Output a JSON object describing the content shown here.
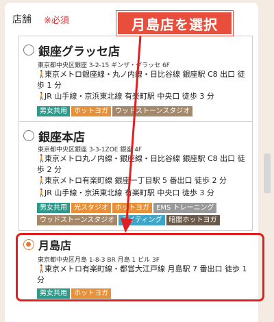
{
  "header": {
    "label": "店舗",
    "required": "※必須",
    "annotation": "月島店を選択"
  },
  "stores": [
    {
      "name": "銀座グラッセ店",
      "selected": false,
      "address": "東京都中央区銀座 3-2-15 ギンザ・グラッセ 6F",
      "routes": [
        "東京メトロ銀座線・丸ノ内線・日比谷線 銀座駅 C8 出口 徒歩 1 分",
        "JR 山手線・京浜東北線 有楽町駅 中央口 徒歩 3 分"
      ],
      "tags": [
        "男女共用",
        "ホットヨガ",
        "ウッドストーンスタジオ"
      ]
    },
    {
      "name": "銀座本店",
      "selected": false,
      "address": "東京都中央区銀座 3-3-1ZOE 銀座 4F",
      "routes": [
        "東京メトロ丸ノ内線・銀座線・日比谷線 銀座駅 C8 出口 徒歩 2 分",
        "東京メトロ有楽町線 銀座一丁目駅 5 番出口 徒歩 2 分",
        "JR 山手線・京浜東北線 有楽町駅 中央口 徒歩 3 分"
      ],
      "tags": [
        "男女共用",
        "光スタジオ",
        "ホットヨガ",
        "EMS トレーニング",
        "ウッドストーンスタジオ",
        "ライティング",
        "暗闇ホットヨガ"
      ]
    },
    {
      "name": "月島店",
      "selected": true,
      "address": "東京都中央区月島 1-8-3 BR 月島 1 ビル 3F",
      "routes": [
        "東京メトロ有楽町線・都営大江戸線 月島駅 7 番出口 徒歩 1 分"
      ],
      "tags": [
        "男女共用",
        "ホットヨガ"
      ]
    }
  ],
  "icons": {
    "walk": "walking-person-icon"
  },
  "colors": {
    "highlight": "#e02020",
    "accent": "#e84e3b",
    "radio_checked": "#e07a3a"
  }
}
